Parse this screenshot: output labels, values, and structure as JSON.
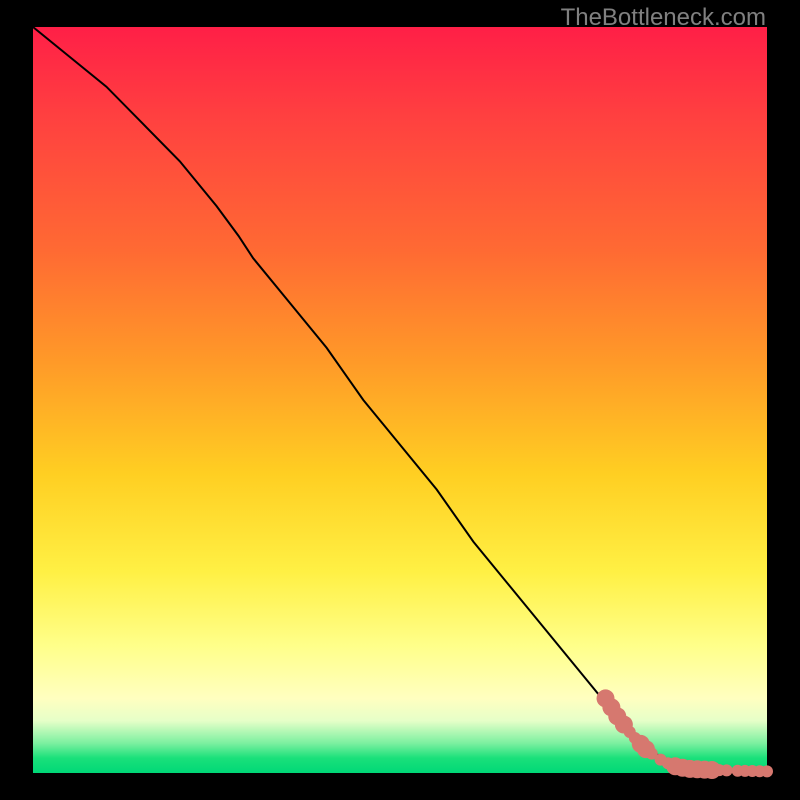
{
  "watermark": "TheBottleneck.com",
  "plot": {
    "gradient_colors": [
      "#ff1f47",
      "#ff4040",
      "#ff6a33",
      "#ff9a28",
      "#ffcf22",
      "#fff044",
      "#ffff8a",
      "#ffffc0",
      "#e6ffc8",
      "#7cf0a0",
      "#1ae07a",
      "#00d877"
    ],
    "line_color": "#000000",
    "marker_color": "#d6786f",
    "marker_radius_small": 6,
    "marker_radius_large": 9
  },
  "chart_data": {
    "type": "line",
    "title": "",
    "xlabel": "",
    "ylabel": "",
    "xlim": [
      0,
      100
    ],
    "ylim": [
      0,
      100
    ],
    "series": [
      {
        "name": "curve",
        "x": [
          0,
          5,
          10,
          15,
          20,
          25,
          28,
          30,
          35,
          40,
          45,
          50,
          55,
          60,
          65,
          70,
          75,
          80,
          82,
          84,
          86,
          88,
          90,
          92,
          94,
          96,
          98,
          100
        ],
        "y": [
          100,
          96,
          92,
          87,
          82,
          76,
          72,
          69,
          63,
          57,
          50,
          44,
          38,
          31,
          25,
          19,
          13,
          7,
          5,
          3,
          2,
          1.2,
          0.7,
          0.5,
          0.4,
          0.3,
          0.25,
          0.2
        ]
      }
    ],
    "markers": [
      {
        "x": 78.0,
        "y": 10.0,
        "size": "large"
      },
      {
        "x": 78.8,
        "y": 8.8,
        "size": "large"
      },
      {
        "x": 79.6,
        "y": 7.6,
        "size": "large"
      },
      {
        "x": 80.5,
        "y": 6.5,
        "size": "large"
      },
      {
        "x": 81.3,
        "y": 5.5,
        "size": "small"
      },
      {
        "x": 82.0,
        "y": 4.7,
        "size": "small"
      },
      {
        "x": 82.8,
        "y": 3.9,
        "size": "large"
      },
      {
        "x": 83.5,
        "y": 3.2,
        "size": "large"
      },
      {
        "x": 84.3,
        "y": 2.6,
        "size": "small"
      },
      {
        "x": 85.5,
        "y": 1.8,
        "size": "small"
      },
      {
        "x": 86.5,
        "y": 1.3,
        "size": "small"
      },
      {
        "x": 87.5,
        "y": 0.9,
        "size": "large"
      },
      {
        "x": 88.5,
        "y": 0.7,
        "size": "large"
      },
      {
        "x": 89.5,
        "y": 0.55,
        "size": "large"
      },
      {
        "x": 90.5,
        "y": 0.5,
        "size": "large"
      },
      {
        "x": 91.5,
        "y": 0.45,
        "size": "large"
      },
      {
        "x": 92.5,
        "y": 0.4,
        "size": "large"
      },
      {
        "x": 93.5,
        "y": 0.38,
        "size": "small"
      },
      {
        "x": 94.5,
        "y": 0.35,
        "size": "small"
      },
      {
        "x": 96.0,
        "y": 0.3,
        "size": "small"
      },
      {
        "x": 97.0,
        "y": 0.28,
        "size": "small"
      },
      {
        "x": 98.0,
        "y": 0.26,
        "size": "small"
      },
      {
        "x": 99.0,
        "y": 0.24,
        "size": "small"
      },
      {
        "x": 100.0,
        "y": 0.22,
        "size": "small"
      }
    ]
  }
}
